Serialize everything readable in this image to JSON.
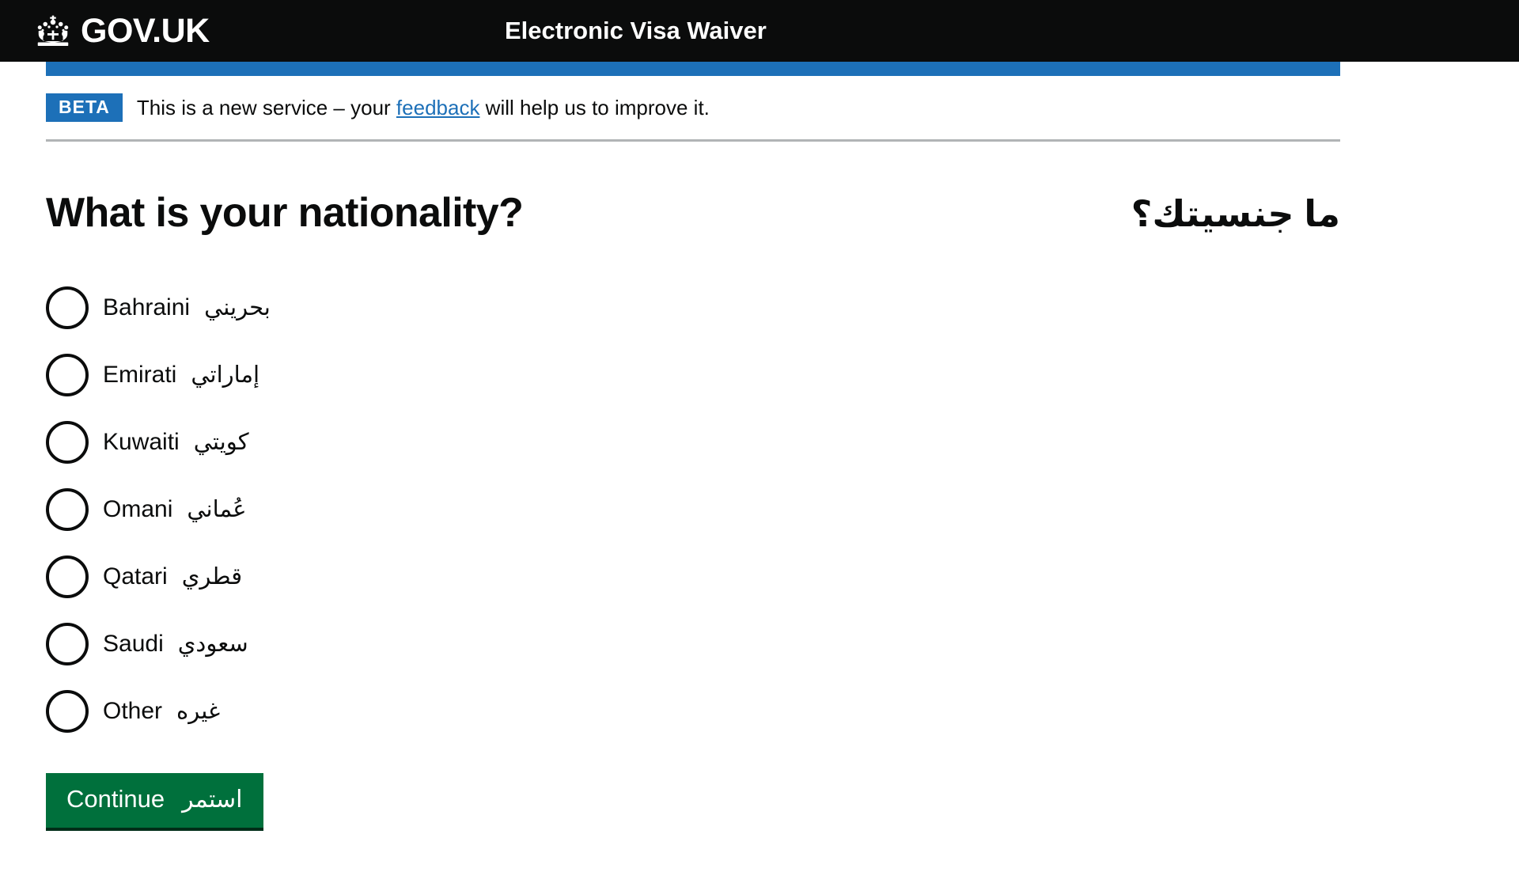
{
  "header": {
    "logo_text": "GOV.UK",
    "crown_icon": "crown-icon",
    "service_name": "Electronic Visa Waiver"
  },
  "phase_banner": {
    "tag": "BETA",
    "text_before_link": "This is a new service – your ",
    "link_text": "feedback",
    "text_after_link": " will help us to improve it."
  },
  "main": {
    "heading_en": "What is your nationality?",
    "heading_ar": "ما جنسيتك؟",
    "options": [
      {
        "en": "Bahraini",
        "ar": "بحريني",
        "selected": false
      },
      {
        "en": "Emirati",
        "ar": "إماراتي",
        "selected": false
      },
      {
        "en": "Kuwaiti",
        "ar": "كويتي",
        "selected": false
      },
      {
        "en": "Omani",
        "ar": "عُماني",
        "selected": false
      },
      {
        "en": "Qatari",
        "ar": "قطري",
        "selected": false
      },
      {
        "en": "Saudi",
        "ar": "سعودي",
        "selected": false
      },
      {
        "en": "Other",
        "ar": "غيره",
        "selected": false
      }
    ],
    "continue_button_en": "Continue",
    "continue_button_ar": "استمر"
  },
  "colors": {
    "header_black": "#0b0c0c",
    "accent_blue": "#1d70b8",
    "button_green": "#00703c",
    "button_green_shadow": "#002d18",
    "divider_grey": "#b1b4b6",
    "text_black": "#0b0c0c",
    "white": "#ffffff"
  }
}
